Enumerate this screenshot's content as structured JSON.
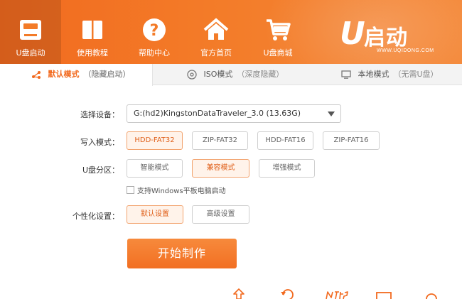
{
  "nav": [
    {
      "label": "U盘启动",
      "icon": "usb-drive-icon"
    },
    {
      "label": "使用教程",
      "icon": "book-icon"
    },
    {
      "label": "帮助中心",
      "icon": "help-icon"
    },
    {
      "label": "官方首页",
      "icon": "home-icon"
    },
    {
      "label": "U盘商城",
      "icon": "cart-icon"
    }
  ],
  "brand": {
    "letter": "U",
    "name": "启动",
    "url": "WWW.UQIDONG.COM"
  },
  "tabs": [
    {
      "label": "默认模式",
      "sub": "（隐藏启动）"
    },
    {
      "label": "ISO模式",
      "sub": "（深度隐藏）"
    },
    {
      "label": "本地模式",
      "sub": "（无需U盘）"
    }
  ],
  "form": {
    "device_label": "选择设备：",
    "device_value": "G:(hd2)KingstonDataTraveler_3.0 (13.63G)",
    "write_label": "写入模式：",
    "write_options": [
      "HDD-FAT32",
      "ZIP-FAT32",
      "HDD-FAT16",
      "ZIP-FAT16"
    ],
    "partition_label": "U盘分区：",
    "partition_options": [
      "智能模式",
      "兼容模式",
      "增强模式"
    ],
    "tablet_checkbox": "支持Windows平板电脑启动",
    "personal_label": "个性化设置：",
    "personal_options": [
      "默认设置",
      "高级设置"
    ],
    "start_button": "开始制作"
  },
  "colors": {
    "accent": "#f26a1f",
    "selected_bg": "#fff3ea"
  }
}
